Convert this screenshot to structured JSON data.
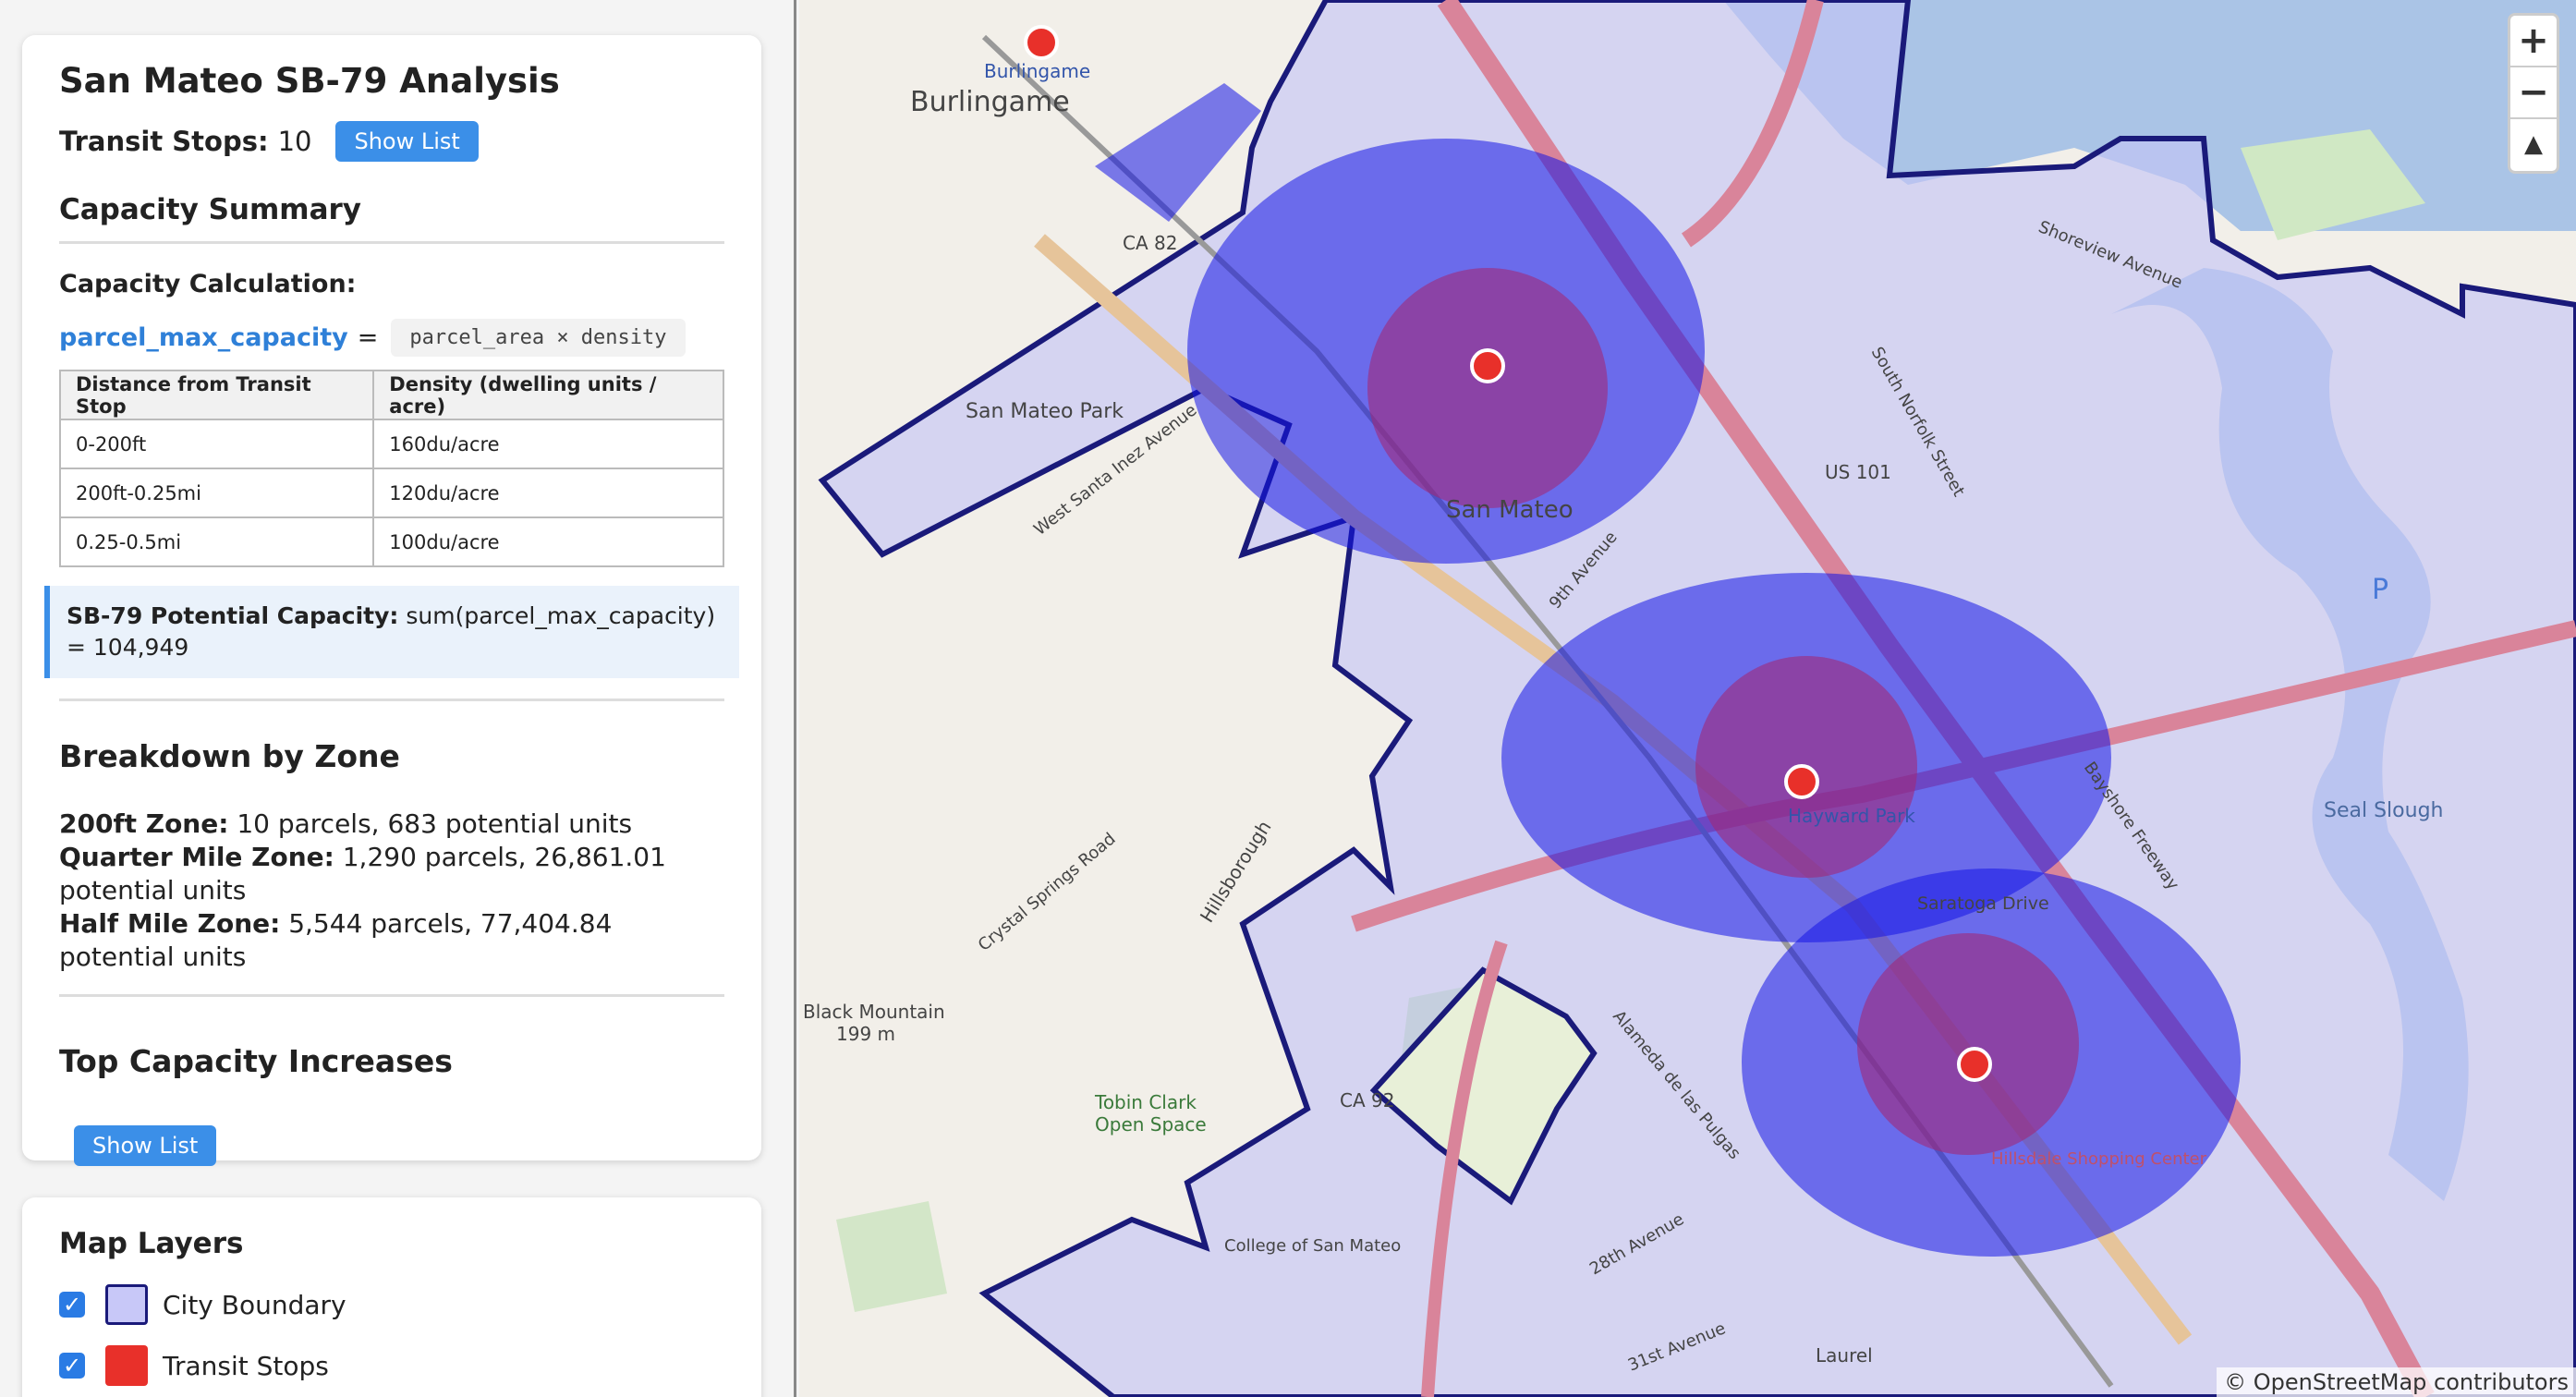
{
  "title": "San Mateo SB-79 Analysis",
  "transit": {
    "label": "Transit Stops:",
    "count": "10",
    "button": "Show List"
  },
  "summary": {
    "heading": "Capacity Summary",
    "calc_title": "Capacity Calculation:",
    "formula_var": "parcel_max_capacity",
    "formula_eq": "=",
    "formula_expr": "parcel_area × density",
    "table": {
      "headers": [
        "Distance from Transit Stop",
        "Density (dwelling units / acre)"
      ],
      "rows": [
        [
          "0-200ft",
          "160du/acre"
        ],
        [
          "200ft-0.25mi",
          "120du/acre"
        ],
        [
          "0.25-0.5mi",
          "100du/acre"
        ]
      ]
    },
    "potential_label": "SB-79 Potential Capacity:",
    "potential_value": "sum(parcel_max_capacity) = 104,949"
  },
  "breakdown": {
    "heading": "Breakdown by Zone",
    "zones": [
      {
        "label": "200ft Zone:",
        "value": "10 parcels, 683 potential units"
      },
      {
        "label": "Quarter Mile Zone:",
        "value": "1,290 parcels, 26,861.01 potential units"
      },
      {
        "label": "Half Mile Zone:",
        "value": "5,544 parcels, 77,404.84 potential units"
      }
    ]
  },
  "top": {
    "heading": "Top Capacity Increases",
    "button": "Show List"
  },
  "layers": {
    "heading": "Map Layers",
    "items": [
      {
        "label": "City Boundary",
        "color": "#c8c8f8",
        "checked": true
      },
      {
        "label": "Transit Stops",
        "color": "#e8302a",
        "checked": true
      }
    ]
  },
  "map": {
    "labels": {
      "burlingame_station": "Burlingame",
      "burlingame": "Burlingame",
      "ca82": "CA 82",
      "us101": "US 101",
      "san_mateo_park": "San Mateo Park",
      "west_santa_inez": "West Santa Inez Avenue",
      "ninth_ave": "9th Avenue",
      "saratoga": "Saratoga Drive",
      "crystal_springs": "Crystal Springs Road",
      "black_mountain": "Black Mountain",
      "black_mountain_elev": "199 m",
      "tobin_clark": "Tobin Clark",
      "open_space": "Open Space",
      "college": "College of San Mateo",
      "alameda": "Alameda de las Pulgas",
      "twenty_eighth": "28th Avenue",
      "thirty_first": "31st Avenue",
      "laurel": "Laurel",
      "seal_slough": "Seal Slough",
      "bayshore": "Bayshore Freeway",
      "south_norfolk": "South Norfolk Street",
      "shoreview": "Shoreview Avenue",
      "hillsborough": "Hillsborough",
      "ca92": "CA 92",
      "hayward_park": "Hayward Park",
      "san_mateo": "San Mateo",
      "hillsdale": "Hillsdale Shopping Center",
      "p": "P"
    },
    "zoom_in": "+",
    "zoom_out": "−",
    "reset": "▲",
    "attribution": "© OpenStreetMap contributors",
    "colors": {
      "boundary": "#1a1a7a",
      "parcel": "#1010ee",
      "stop": "#e8302a",
      "water": "#aac4e6"
    }
  }
}
